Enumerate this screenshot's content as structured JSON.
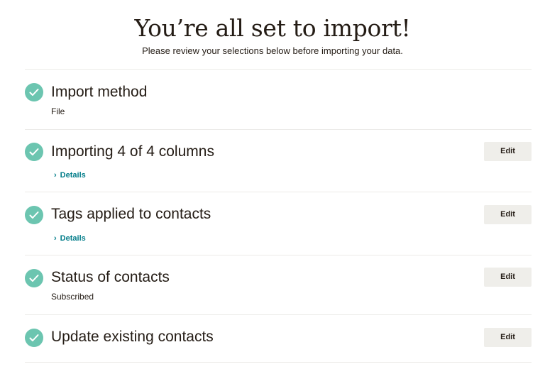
{
  "header": {
    "title": "You’re all set to import!",
    "subtitle": "Please review your selections below before importing your data."
  },
  "sections": [
    {
      "title": "Import method",
      "subtitle": "File",
      "completed": true
    },
    {
      "title": "Importing 4 of 4 columns",
      "link": "Details",
      "edit_label": "Edit",
      "completed": true
    },
    {
      "title": "Tags applied to contacts",
      "link": "Details",
      "edit_label": "Edit",
      "completed": true
    },
    {
      "title": "Status of contacts",
      "subtitle": "Subscribed",
      "edit_label": "Edit",
      "completed": true
    },
    {
      "title": "Update existing contacts",
      "edit_label": "Edit",
      "completed": true
    }
  ],
  "icons": {
    "check": "check-circle-icon",
    "chevron": "chevron-right-icon"
  },
  "colors": {
    "check_circle": "#6cc5b0",
    "link": "#007c89",
    "edit_button_bg": "#efeeea",
    "text": "#241c15",
    "divider": "#ecebe8"
  }
}
